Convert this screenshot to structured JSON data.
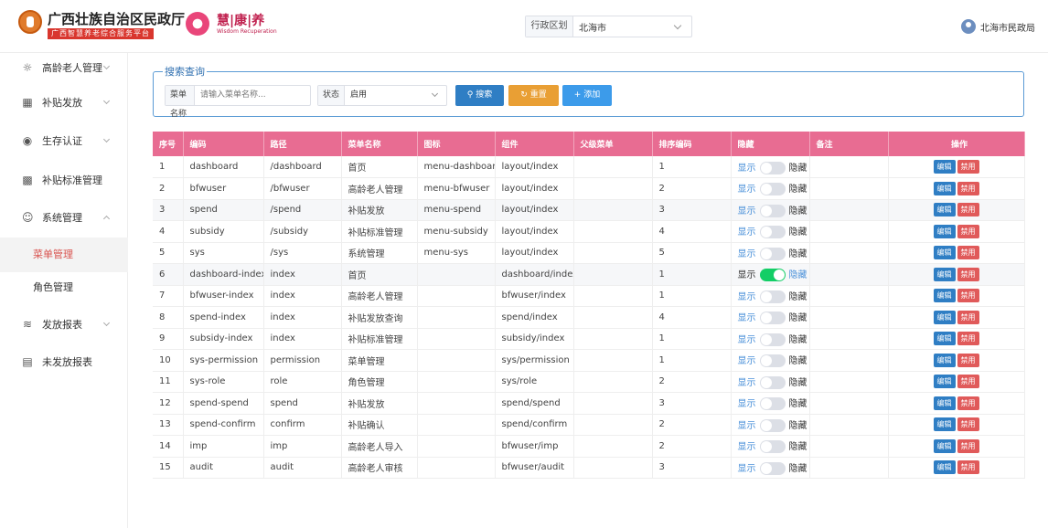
{
  "header": {
    "gov_title": "广西壮族自治区民政厅",
    "gov_subtitle": "广西智慧养老综合服务平台",
    "brand_name": "慧|康|养",
    "brand_en": "Wisdom Recuperation",
    "region_label": "行政区划",
    "region_value": "北海市",
    "user_name": "北海市民政局"
  },
  "sidebar": {
    "items": [
      {
        "label": "高龄老人管理",
        "icon": "elderly-icon"
      },
      {
        "label": "补贴发放",
        "icon": "subsidy-icon"
      },
      {
        "label": "生存认证",
        "icon": "verify-icon"
      },
      {
        "label": "补贴标准管理",
        "icon": "standard-icon"
      },
      {
        "label": "系统管理",
        "icon": "system-icon"
      },
      {
        "label": "发放报表",
        "icon": "report-icon"
      },
      {
        "label": "未发放报表",
        "icon": "unreport-icon"
      }
    ],
    "sub_items": [
      {
        "label": "菜单管理",
        "active": true
      },
      {
        "label": "角色管理",
        "active": false
      }
    ]
  },
  "search": {
    "legend": "搜索查询",
    "menu_name_label": "菜单名称",
    "menu_name_placeholder": "请输入菜单名称...",
    "status_label": "状态",
    "status_value": "启用",
    "search_button": "搜索",
    "reset_button": "重置",
    "add_button": "添加"
  },
  "table": {
    "columns": [
      "序号",
      "编码",
      "路径",
      "菜单名称",
      "图标",
      "组件",
      "父级菜单",
      "排序编码",
      "隐藏",
      "备注",
      "操作"
    ],
    "show_label": "显示",
    "hide_label": "隐藏",
    "edit_label": "编辑",
    "disable_label": "禁用",
    "rows": [
      {
        "no": "1",
        "code": "dashboard",
        "path": "/dashboard",
        "name": "首页",
        "icon": "menu-dashboard",
        "component": "layout/index",
        "parent": "",
        "sort": "1",
        "visible": false
      },
      {
        "no": "2",
        "code": "bfwuser",
        "path": "/bfwuser",
        "name": "高龄老人管理",
        "icon": "menu-bfwuser",
        "component": "layout/index",
        "parent": "",
        "sort": "2",
        "visible": false
      },
      {
        "no": "3",
        "code": "spend",
        "path": "/spend",
        "name": "补贴发放",
        "icon": "menu-spend",
        "component": "layout/index",
        "parent": "",
        "sort": "3",
        "visible": false
      },
      {
        "no": "4",
        "code": "subsidy",
        "path": "/subsidy",
        "name": "补贴标准管理",
        "icon": "menu-subsidy",
        "component": "layout/index",
        "parent": "",
        "sort": "4",
        "visible": false
      },
      {
        "no": "5",
        "code": "sys",
        "path": "/sys",
        "name": "系统管理",
        "icon": "menu-sys",
        "component": "layout/index",
        "parent": "",
        "sort": "5",
        "visible": false
      },
      {
        "no": "6",
        "code": "dashboard-index",
        "path": "index",
        "name": "首页",
        "icon": "",
        "component": "dashboard/index",
        "parent": "",
        "sort": "1",
        "visible": true
      },
      {
        "no": "7",
        "code": "bfwuser-index",
        "path": "index",
        "name": "高龄老人管理",
        "icon": "",
        "component": "bfwuser/index",
        "parent": "",
        "sort": "1",
        "visible": false
      },
      {
        "no": "8",
        "code": "spend-index",
        "path": "index",
        "name": "补贴发放查询",
        "icon": "",
        "component": "spend/index",
        "parent": "",
        "sort": "4",
        "visible": false
      },
      {
        "no": "9",
        "code": "subsidy-index",
        "path": "index",
        "name": "补贴标准管理",
        "icon": "",
        "component": "subsidy/index",
        "parent": "",
        "sort": "1",
        "visible": false
      },
      {
        "no": "10",
        "code": "sys-permission",
        "path": "permission",
        "name": "菜单管理",
        "icon": "",
        "component": "sys/permission",
        "parent": "",
        "sort": "1",
        "visible": false
      },
      {
        "no": "11",
        "code": "sys-role",
        "path": "role",
        "name": "角色管理",
        "icon": "",
        "component": "sys/role",
        "parent": "",
        "sort": "2",
        "visible": false
      },
      {
        "no": "12",
        "code": "spend-spend",
        "path": "spend",
        "name": "补贴发放",
        "icon": "",
        "component": "spend/spend",
        "parent": "",
        "sort": "3",
        "visible": false
      },
      {
        "no": "13",
        "code": "spend-confirm",
        "path": "confirm",
        "name": "补贴确认",
        "icon": "",
        "component": "spend/confirm",
        "parent": "",
        "sort": "2",
        "visible": false
      },
      {
        "no": "14",
        "code": "imp",
        "path": "imp",
        "name": "高龄老人导入",
        "icon": "",
        "component": "bfwuser/imp",
        "parent": "",
        "sort": "2",
        "visible": false
      },
      {
        "no": "15",
        "code": "audit",
        "path": "audit",
        "name": "高龄老人审核",
        "icon": "",
        "component": "bfwuser/audit",
        "parent": "",
        "sort": "3",
        "visible": false
      }
    ]
  }
}
